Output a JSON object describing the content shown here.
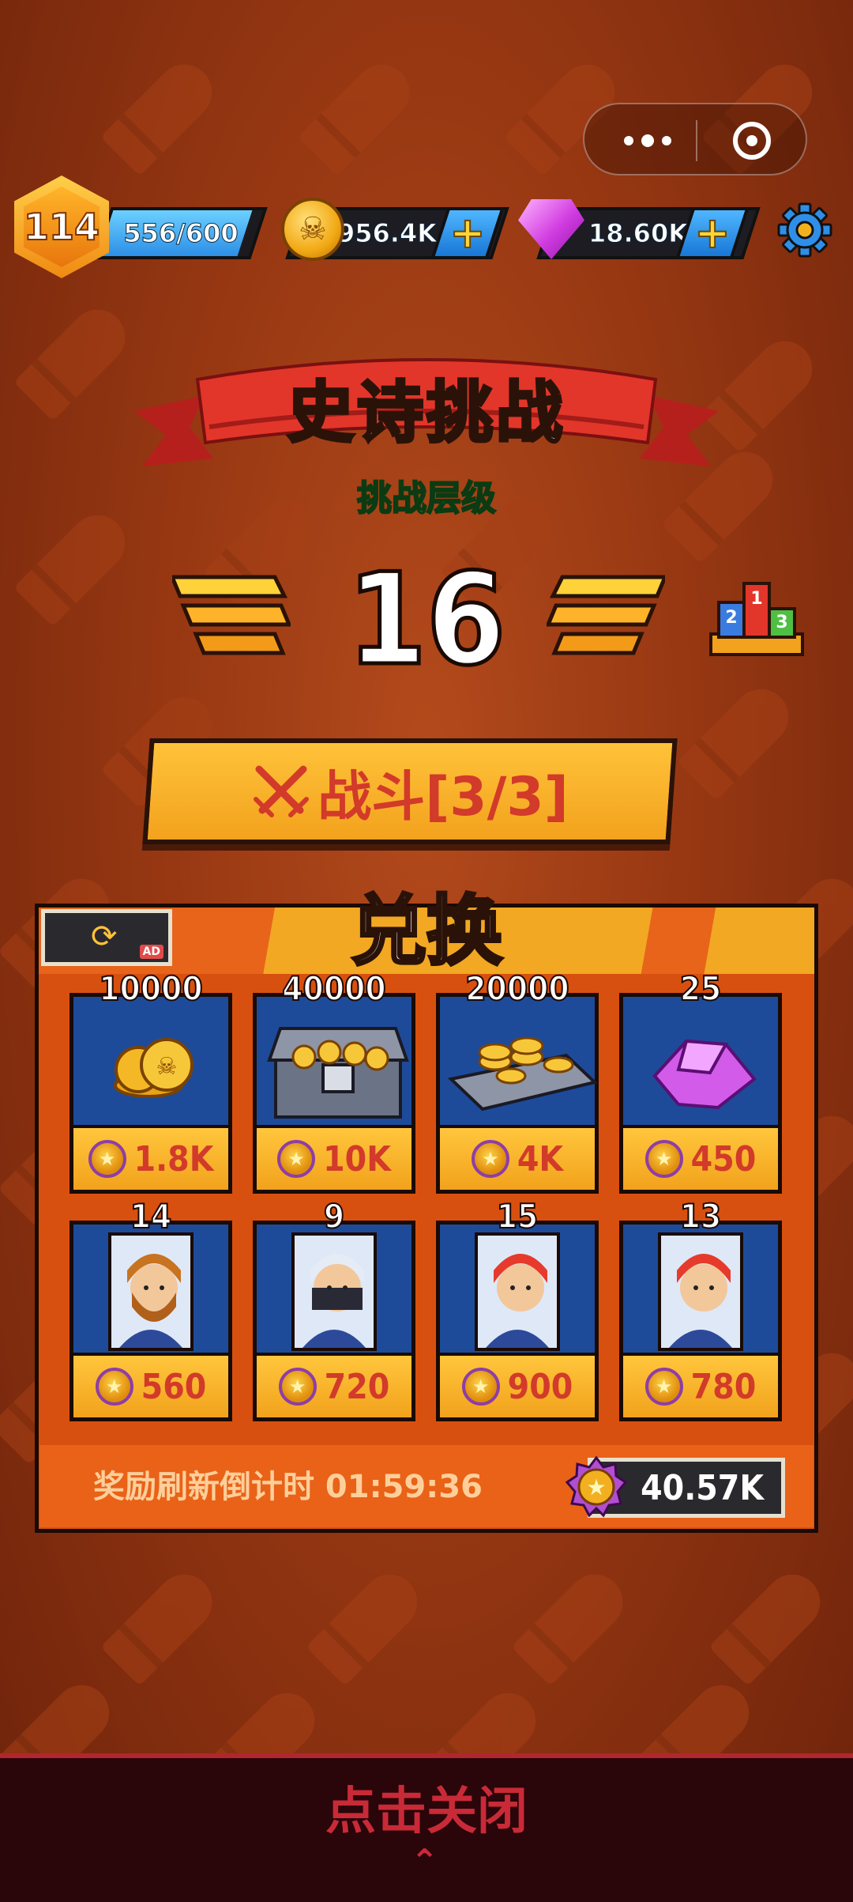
{
  "topbar": {
    "level": "114",
    "xp": "556/600",
    "xp_progress": 0.9267,
    "coins": "956.4K",
    "gems": "18.60K",
    "plus_label": "+"
  },
  "header": {
    "title": "史诗挑战",
    "subtitle": "挑战层级",
    "stage": "16"
  },
  "battle": {
    "label": "战斗[3/3]"
  },
  "exchange": {
    "title": "兑换",
    "ad_label": "AD",
    "items": [
      {
        "qty": "10000",
        "price": "1.8K",
        "icon": "coin-pile-icon"
      },
      {
        "qty": "40000",
        "price": "10K",
        "icon": "treasure-chest-icon"
      },
      {
        "qty": "20000",
        "price": "4K",
        "icon": "coin-tray-icon"
      },
      {
        "qty": "25",
        "price": "450",
        "icon": "gem-icon"
      },
      {
        "qty": "14",
        "price": "560",
        "icon": "hero-bearded-icon"
      },
      {
        "qty": "9",
        "price": "720",
        "icon": "hero-ninja-icon"
      },
      {
        "qty": "15",
        "price": "900",
        "icon": "hero-redhair-icon"
      },
      {
        "qty": "13",
        "price": "780",
        "icon": "hero-redhair-icon"
      }
    ],
    "countdown": "奖励刷新倒计时 01:59:36",
    "balance": "40.57K"
  },
  "footer": {
    "close_label": "点击关闭",
    "chevron": "⌃"
  },
  "colors": {
    "accent": "#f2a21c",
    "panel": "#d8500f",
    "cell": "#1e4d9e",
    "price": "#d23a2a",
    "close": "#c92a38"
  }
}
